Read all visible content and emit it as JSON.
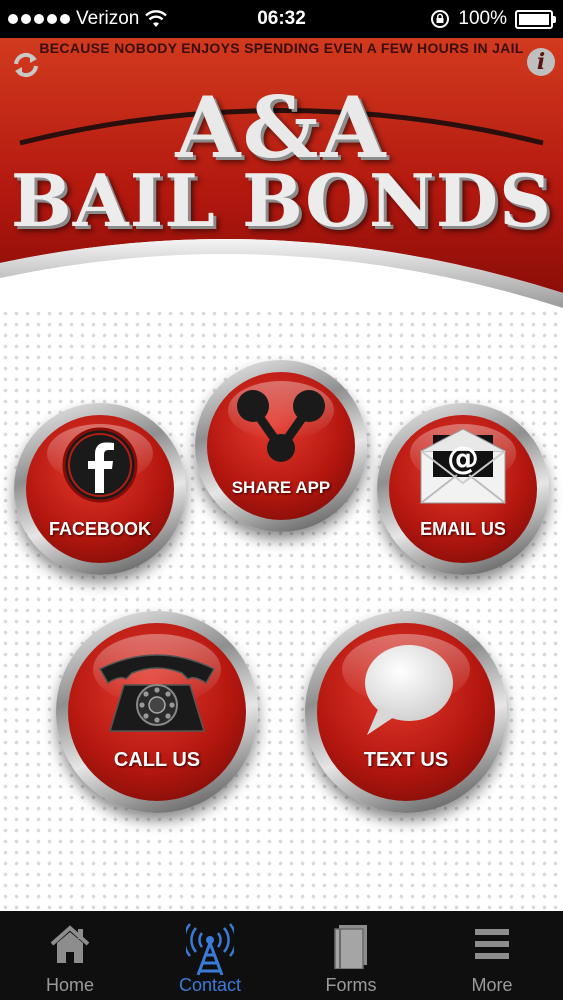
{
  "status_bar": {
    "carrier": "Verizon",
    "time": "06:32",
    "battery": "100%"
  },
  "header": {
    "ticker": "BECAUSE NOBODY ENJOYS SPENDING EVEN A FEW HOURS IN JAIL",
    "logo_line1": "A&A",
    "logo_line2": "BAIL BONDS"
  },
  "buttons": {
    "facebook": "FACEBOOK",
    "share": "SHARE APP",
    "email": "EMAIL US",
    "call": "CALL US",
    "text": "TEXT US"
  },
  "tabs": [
    {
      "label": "Home",
      "icon": "home-icon"
    },
    {
      "label": "Contact",
      "icon": "antenna-icon",
      "active": true
    },
    {
      "label": "Forms",
      "icon": "book-icon"
    },
    {
      "label": "More",
      "icon": "menu-icon"
    }
  ],
  "colors": {
    "brand_red": "#c0221a",
    "active_tab": "#3b7bd8",
    "tab_bar": "#0f0f0f"
  }
}
